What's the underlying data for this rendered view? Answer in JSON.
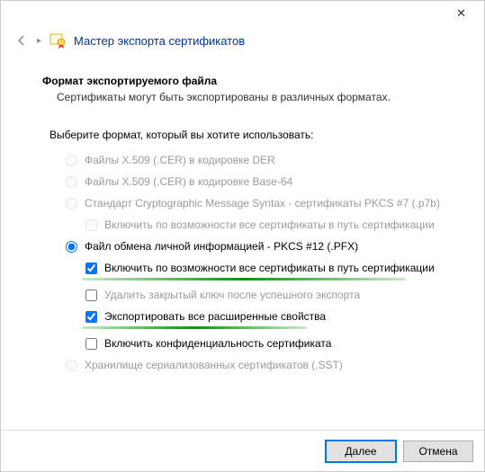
{
  "window": {
    "title": "Мастер экспорта сертификатов"
  },
  "section": {
    "heading": "Формат экспортируемого файла",
    "sub": "Сертификаты могут быть экспортированы в различных форматах."
  },
  "prompt": "Выберите формат, который вы хотите использовать:",
  "radios": {
    "der": "Файлы X.509 (.CER) в кодировке DER",
    "base64": "Файлы X.509 (.CER) в кодировке Base-64",
    "pkcs7": "Стандарт Cryptographic Message Syntax - сертификаты PKCS #7 (.p7b)",
    "pfx": "Файл обмена личной информацией - PKCS #12 (.PFX)",
    "sst": "Хранилище сериализованных сертификатов (.SST)"
  },
  "checks": {
    "pkcs7_chain": "Включить по возможности все сертификаты в путь сертификации",
    "pfx_chain": "Включить по возможности все сертификаты в путь сертификации",
    "pfx_delkey": "Удалить закрытый ключ после успешного экспорта",
    "pfx_ext": "Экспортировать все расширенные свойства",
    "pfx_priv": "Включить конфиденциальность сертификата"
  },
  "buttons": {
    "next": "Далее",
    "cancel": "Отмена"
  }
}
